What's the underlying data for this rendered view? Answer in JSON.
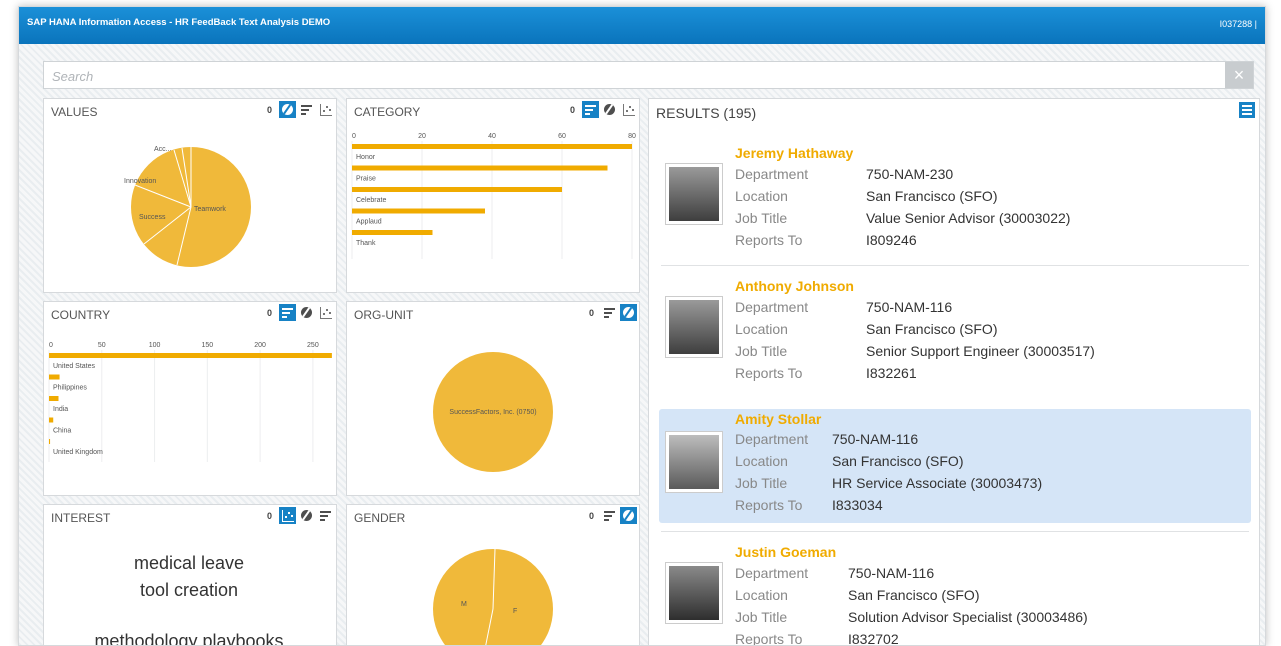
{
  "app": {
    "title": "SAP HANA Information Access - HR FeedBack Text Analysis DEMO",
    "user": "I037288  |"
  },
  "search": {
    "placeholder": "Search",
    "clear": "×"
  },
  "colors": {
    "bar": "#f0ab00",
    "pie": "#f0b93a",
    "accent": "#1782c5",
    "name": "#f0ab00"
  },
  "facets": {
    "values": {
      "title": "VALUES",
      "count": "0",
      "labels": [
        "Acc...",
        "Innovation",
        "Success",
        "Teamwork"
      ]
    },
    "category": {
      "title": "CATEGORY",
      "count": "0"
    },
    "country": {
      "title": "COUNTRY",
      "count": "0"
    },
    "org_unit": {
      "title": "ORG-UNIT",
      "count": "0",
      "label": "SuccessFactors, Inc. (0750)"
    },
    "interest": {
      "title": "INTEREST",
      "count": "0",
      "terms": [
        "medical leave",
        "tool creation",
        "methodology playbooks"
      ]
    },
    "gender": {
      "title": "GENDER",
      "count": "0",
      "labels": [
        "M",
        "F"
      ]
    }
  },
  "chart_data": [
    {
      "type": "bar",
      "orientation": "horizontal",
      "name": "CATEGORY",
      "categories": [
        "Honor",
        "Praise",
        "Celebrate",
        "Applaud",
        "Thank"
      ],
      "values": [
        80,
        73,
        60,
        38,
        23
      ],
      "xlim": [
        0,
        80
      ],
      "ticks": [
        "0",
        "20",
        "40",
        "60",
        "80"
      ]
    },
    {
      "type": "bar",
      "orientation": "horizontal",
      "name": "COUNTRY",
      "categories": [
        "United States",
        "Philippines",
        "India",
        "China",
        "United Kingdom"
      ],
      "values": [
        268,
        10,
        9,
        4,
        1
      ],
      "xlim": [
        0,
        270
      ],
      "ticks": [
        "0",
        "50",
        "100",
        "150",
        "200",
        "250"
      ]
    }
  ],
  "results": {
    "title": "RESULTS (195)",
    "field_labels": {
      "department": "Department",
      "location": "Location",
      "job_title": "Job Title",
      "reports_to": "Reports To"
    },
    "items": [
      {
        "name": "Jeremy Hathaway",
        "department": "750-NAM-230",
        "location": "San Francisco (SFO)",
        "job_title": "Value Senior Advisor (30003022)",
        "reports_to": "I809246"
      },
      {
        "name": "Anthony Johnson",
        "department": "750-NAM-116",
        "location": "San Francisco (SFO)",
        "job_title": "Senior Support Engineer (30003517)",
        "reports_to": "I832261"
      },
      {
        "name": "Amity Stollar",
        "department": "750-NAM-116",
        "location": "San Francisco (SFO)",
        "job_title": "HR Service Associate (30003473)",
        "reports_to": "I833034"
      },
      {
        "name": "Justin Goeman",
        "department": "750-NAM-116",
        "location": "San Francisco (SFO)",
        "job_title": "Solution Advisor Specialist (30003486)",
        "reports_to": "I832702"
      }
    ]
  }
}
